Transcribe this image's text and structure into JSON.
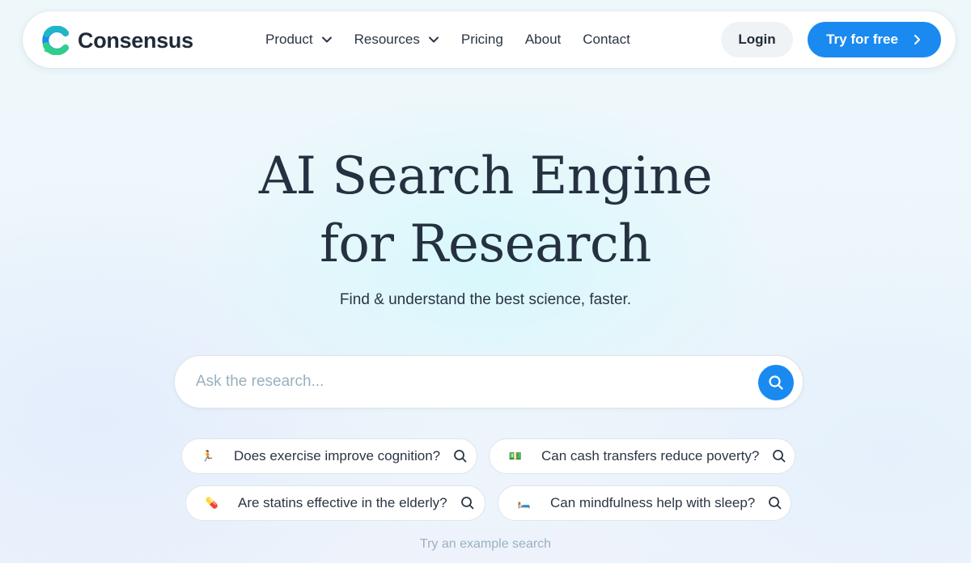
{
  "brand": {
    "name": "Consensus",
    "accent": "#1a8af0",
    "logo_colors": [
      "#1fb6c8",
      "#1a8af0",
      "#2fcf8a"
    ]
  },
  "nav": {
    "menu": [
      {
        "label": "Product",
        "has_dropdown": true
      },
      {
        "label": "Resources",
        "has_dropdown": true
      },
      {
        "label": "Pricing",
        "has_dropdown": false
      },
      {
        "label": "About",
        "has_dropdown": false
      },
      {
        "label": "Contact",
        "has_dropdown": false
      }
    ],
    "login_label": "Login",
    "try_label": "Try for free"
  },
  "hero": {
    "title_line1": "AI Search Engine",
    "title_line2": "for Research",
    "subtitle": "Find & understand the best science, faster."
  },
  "search": {
    "placeholder": "Ask the research...",
    "value": ""
  },
  "suggestions": [
    {
      "emoji": "🏃",
      "text": "Does exercise improve cognition?"
    },
    {
      "emoji": "💵",
      "text": "Can cash transfers reduce poverty?"
    },
    {
      "emoji": "💊",
      "text": "Are statins effective in the elderly?"
    },
    {
      "emoji": "🛏️",
      "text": "Can mindfulness help with sleep?"
    }
  ],
  "example_hint": "Try an example search"
}
